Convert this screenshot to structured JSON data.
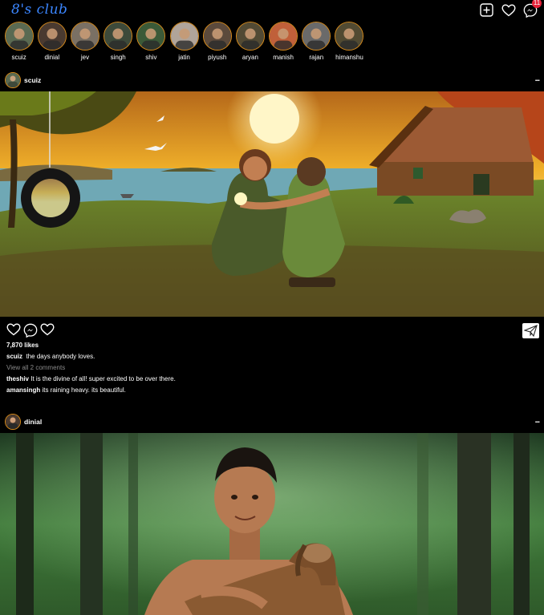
{
  "app": {
    "title": "8's club",
    "notification_count": "11"
  },
  "header_icons": [
    "add-post-icon",
    "heart-icon",
    "messenger-icon"
  ],
  "stories": [
    {
      "name": "scuiz",
      "color": "#5a6a52"
    },
    {
      "name": "dinial",
      "color": "#4a3a30"
    },
    {
      "name": "jev",
      "color": "#7a7064"
    },
    {
      "name": "singh",
      "color": "#3d4a3a"
    },
    {
      "name": "shiv",
      "color": "#3b5a38"
    },
    {
      "name": "jatin",
      "color": "#b0a49a"
    },
    {
      "name": "piyush",
      "color": "#5c4a3c"
    },
    {
      "name": "aryan",
      "color": "#524a34"
    },
    {
      "name": "manish",
      "color": "#c0603a"
    },
    {
      "name": "rajan",
      "color": "#6a6a6a"
    },
    {
      "name": "himanshu",
      "color": "#514a32"
    }
  ],
  "posts": [
    {
      "user": "scuiz",
      "likes": "7,870 likes",
      "caption_user": "scuiz",
      "caption_text": "the days anybody loves.",
      "view_all": "View all 2 comments",
      "comments": [
        {
          "user": "theshiv",
          "text": "It is the divine of all! super excited to be over there."
        },
        {
          "user": "amansingh",
          "text": "its raining heavy. its beautiful."
        }
      ]
    },
    {
      "user": "dinial"
    }
  ],
  "more_label": "..."
}
